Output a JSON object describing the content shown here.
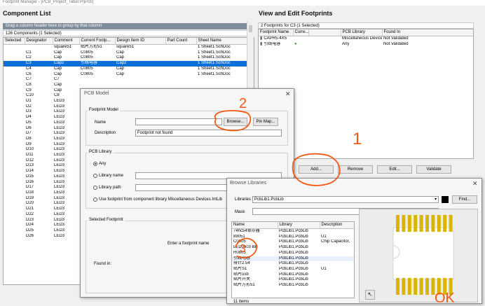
{
  "window": {
    "title": "Footprint Manager - [PCB_Project_Tabel.PrjPcb]"
  },
  "component_list": {
    "title": "Component List",
    "group_hint": "Drag a column header here to group by that column",
    "count": "126 Components (1 Selected)",
    "columns": [
      "Selected",
      "Designator",
      "Comment",
      "Current Footp...",
      "Design Item ID",
      "Part Count",
      "Sheet Name"
    ],
    "rows": [
      [
        "",
        "",
        "square51",
        "贴片方形51",
        "square51",
        "",
        "1 Sheet1.SchDoc"
      ],
      [
        "",
        "C1",
        "Cap",
        "C0805",
        "Cap",
        "",
        "1 Sheet1.SchDoc"
      ],
      [
        "",
        "C2",
        "Cap",
        "C0805",
        "Cap",
        "",
        "1 Sheet1.SchDoc"
      ],
      [
        "",
        "C3",
        "Cap2",
        "引线电容",
        "Cap2",
        "",
        "1 Sheet1.SchDoc"
      ],
      [
        "",
        "C4",
        "Cap",
        "C0805",
        "Cap",
        "",
        "1 Sheet1.SchDoc"
      ],
      [
        "",
        "C6",
        "Cap",
        "C0805",
        "Cap",
        "",
        "1 Sheet1.SchDoc"
      ],
      [
        "",
        "C7",
        "C7",
        "",
        "",
        "",
        ""
      ],
      [
        "",
        "C8",
        "Cap",
        "",
        "",
        "",
        ""
      ],
      [
        "",
        "C9",
        "Cap",
        "",
        "",
        "",
        ""
      ],
      [
        "",
        "C10",
        "C8",
        "",
        "",
        "",
        ""
      ],
      [
        "",
        "D1",
        "LED3",
        "",
        "",
        "",
        ""
      ],
      [
        "",
        "D2",
        "LED3",
        "",
        "",
        "",
        ""
      ],
      [
        "",
        "D3",
        "LED3",
        "",
        "",
        "",
        ""
      ],
      [
        "",
        "D4",
        "LED3",
        "",
        "",
        "",
        ""
      ],
      [
        "",
        "D5",
        "LED3",
        "",
        "",
        "",
        ""
      ],
      [
        "",
        "D6",
        "LED3",
        "",
        "",
        "",
        ""
      ],
      [
        "",
        "D7",
        "LED3",
        "",
        "",
        "",
        ""
      ],
      [
        "",
        "D8",
        "LED3",
        "",
        "",
        "",
        ""
      ],
      [
        "",
        "D9",
        "LED3",
        "",
        "",
        "",
        ""
      ],
      [
        "",
        "D10",
        "LED3",
        "",
        "",
        "",
        ""
      ],
      [
        "",
        "D11",
        "LED3",
        "",
        "",
        "",
        ""
      ],
      [
        "",
        "D12",
        "LED3",
        "",
        "",
        "",
        ""
      ],
      [
        "",
        "D13",
        "LED3",
        "",
        "",
        "",
        ""
      ],
      [
        "",
        "D14",
        "LED3",
        "",
        "",
        "",
        ""
      ],
      [
        "",
        "D15",
        "LED3",
        "",
        "",
        "",
        ""
      ],
      [
        "",
        "D16",
        "LED3",
        "",
        "",
        "",
        ""
      ],
      [
        "",
        "D17",
        "LED3",
        "",
        "",
        "",
        ""
      ],
      [
        "",
        "D18",
        "LED3",
        "",
        "",
        "",
        ""
      ],
      [
        "",
        "D19",
        "LED3",
        "",
        "",
        "",
        ""
      ],
      [
        "",
        "D20",
        "LED3",
        "",
        "",
        "",
        ""
      ],
      [
        "",
        "D21",
        "LED3",
        "",
        "",
        "",
        ""
      ],
      [
        "",
        "D22",
        "LED3",
        "",
        "",
        "",
        ""
      ],
      [
        "",
        "D23",
        "LED3",
        "",
        "",
        "",
        ""
      ],
      [
        "",
        "D24",
        "LED3",
        "",
        "",
        "",
        ""
      ],
      [
        "",
        "D25",
        "LED3",
        "",
        "",
        "",
        ""
      ],
      [
        "",
        "D26",
        "LED3",
        "",
        "",
        "",
        ""
      ]
    ]
  },
  "footprints": {
    "title": "View and Edit Footprints",
    "count": "2 Footprints for C3 (1 Selected)",
    "columns": [
      "Footprint Name",
      "Curre...",
      "",
      "PCB Library",
      "Found In"
    ],
    "rows": [
      [
        "CAPR5-4X5",
        "",
        "Miscellaneous Devices...",
        "Not Validated"
      ],
      [
        "引线电容",
        "",
        "Any",
        "Not Validated"
      ]
    ],
    "buttons": {
      "add": "Add...",
      "remove": "Remove",
      "edit": "Edit...",
      "validate": "Validate"
    }
  },
  "pcb_model": {
    "title": "PCB Model",
    "footprint_model_label": "Footprint Model",
    "name_label": "Name",
    "name_value": "",
    "browse": "Browse...",
    "pin_map": "Pin Map...",
    "description_label": "Description",
    "description_value": "Footprint not found",
    "pcb_library_label": "PCB Library",
    "options": [
      "Any",
      "Library name",
      "Library path",
      "Use footprint from component library Miscellaneous Devices.IntLib"
    ],
    "selected_footprint_label": "Selected Footprint",
    "placeholder": "Enter a footprint name",
    "found_in_label": "Found in:"
  },
  "browse": {
    "title": "Browse Libraries",
    "libraries_label": "Libraries",
    "libraries_value": "PcbLib1.PcbLib",
    "find": "Find...",
    "mask_label": "Mask",
    "columns": [
      "Name",
      "Library",
      "Description"
    ],
    "rows": [
      [
        "74hc54锁存器",
        "PcbLib1.PcbLib",
        ""
      ],
      [
        "89051",
        "PcbLib1.PcbLib",
        "U1"
      ],
      [
        "C0805",
        "PcbLib1.PcbLib",
        "Chip Capacitor,"
      ],
      [
        "LED0603 BB",
        "PcbLib1.PcbLib",
        ""
      ],
      [
        "R0805",
        "PcbLib1.PcbLib",
        ""
      ],
      [
        "引线电容",
        "PcbLib1.PcbLib",
        ""
      ],
      [
        "排针2.54",
        "PcbLib1.PcbLib",
        ""
      ],
      [
        "贴片S1",
        "PcbLib1.PcbLib",
        "U1"
      ],
      [
        "贴片usb",
        "PcbLib1.PcbLib",
        ""
      ],
      [
        "贴片开关",
        "PcbLib1.PcbLib",
        ""
      ],
      [
        "贴片方形51",
        "PcbLib1.PcbLib",
        ""
      ]
    ],
    "items_count": "11 items"
  },
  "annotations": {
    "one": "1",
    "two": "2",
    "three": "3",
    "ok": "OK"
  },
  "colors": {
    "selection": "#0a6fd6",
    "annotation": "#f05a14",
    "pad": "#d9b400",
    "preview_bg": "#f0f0f0"
  }
}
